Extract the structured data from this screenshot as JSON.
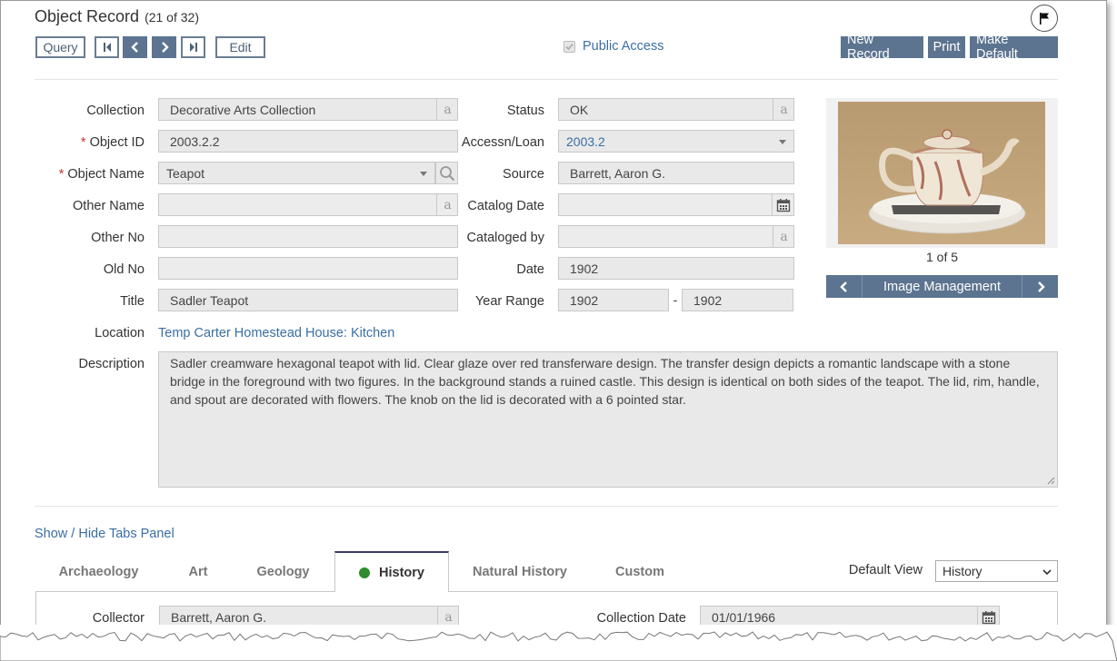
{
  "header": {
    "title": "Object Record",
    "record_count": "(21 of 32)"
  },
  "toolbar": {
    "query_label": "Query",
    "edit_label": "Edit",
    "public_access_label": "Public Access",
    "new_record_label": "New Record",
    "print_label": "Print",
    "make_default_label": "Make Default"
  },
  "form": {
    "collection_label": "Collection",
    "collection_value": "Decorative Arts Collection",
    "object_id_label": "Object ID",
    "object_id_value": "2003.2.2",
    "object_name_label": "Object Name",
    "object_name_value": "Teapot",
    "other_name_label": "Other Name",
    "other_no_label": "Other No",
    "old_no_label": "Old No",
    "title_label": "Title",
    "title_value": "Sadler Teapot",
    "location_label": "Location",
    "location_value": "Temp Carter Homestead House: Kitchen",
    "description_label": "Description",
    "description_value": "Sadler creamware hexagonal teapot with lid. Clear glaze over red transferware design. The transfer design depicts a romantic landscape with a stone bridge in the foreground with two figures. In the background stands a ruined castle. This design is identical on both sides of the teapot. The lid, rim, handle, and spout are decorated with flowers. The knob on the lid is  decorated with a 6 pointed star.",
    "status_label": "Status",
    "status_value": "OK",
    "accessn_label": "Accessn/Loan",
    "accessn_value": "2003.2",
    "source_label": "Source",
    "source_value": "Barrett, Aaron G.",
    "catalog_date_label": "Catalog Date",
    "cataloged_by_label": "Cataloged by",
    "date_label": "Date",
    "date_value": "1902",
    "year_range_label": "Year Range",
    "year_from": "1902",
    "year_sep": "-",
    "year_to": "1902",
    "a_glyph": "a"
  },
  "image_panel": {
    "counter": "1 of 5",
    "management_label": "Image Management"
  },
  "tabs_panel": {
    "toggle_label": "Show / Hide Tabs Panel",
    "tabs": [
      "Archaeology",
      "Art",
      "Geology",
      "History",
      "Natural History",
      "Custom"
    ],
    "active_tab": "History",
    "default_view_label": "Default View",
    "default_view_value": "History",
    "collector_label": "Collector",
    "collector_value": "Barrett, Aaron G.",
    "collection_date_label": "Collection Date",
    "collection_date_value": "01/01/1966"
  },
  "colors": {
    "accent_button": "#5c7490",
    "link": "#3a6ea5",
    "required": "#c0392b",
    "active_dot": "#2e8b2e"
  },
  "icons": [
    "flag-icon",
    "first-icon",
    "prev-icon",
    "next-icon",
    "last-icon",
    "search-icon",
    "calendar-icon",
    "dropdown-icon"
  ]
}
